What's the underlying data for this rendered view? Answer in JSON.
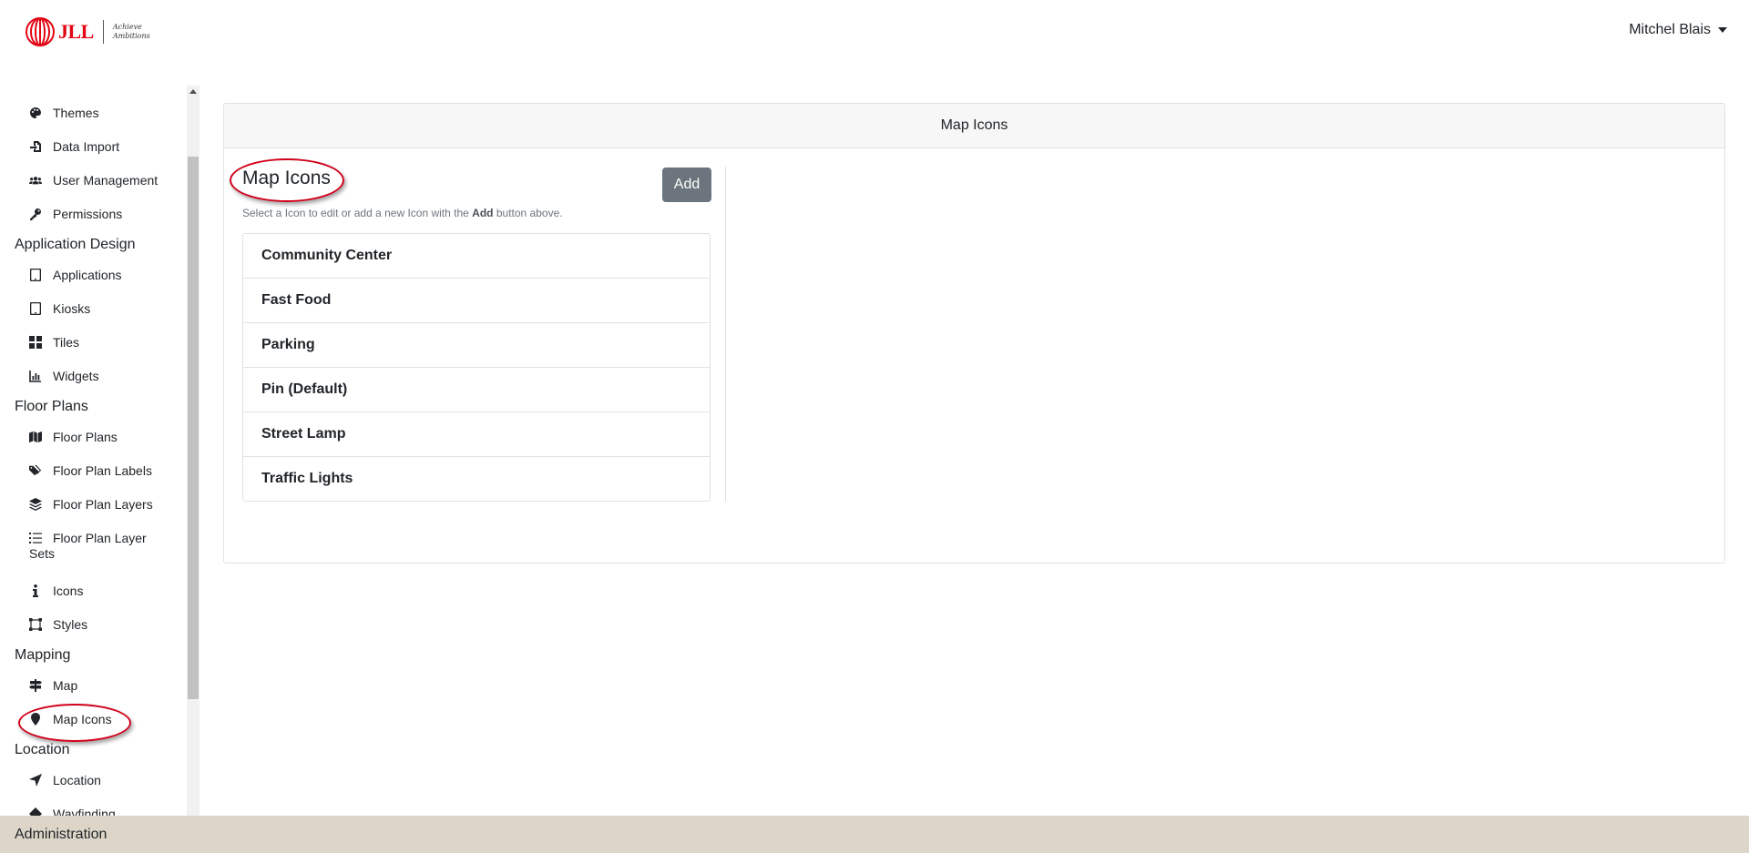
{
  "brand": {
    "logo_text": "JLL",
    "tagline": "Achieve Ambitions",
    "primary_color": "#e30613"
  },
  "user": {
    "name": "Mitchel Blais"
  },
  "sidebar": {
    "groups": [
      {
        "title": "",
        "items": [
          {
            "label": "Themes",
            "icon": "palette-icon"
          },
          {
            "label": "Data Import",
            "icon": "file-import-icon"
          },
          {
            "label": "User Management",
            "icon": "users-icon"
          },
          {
            "label": "Permissions",
            "icon": "key-icon"
          }
        ]
      },
      {
        "title": "Application Design",
        "items": [
          {
            "label": "Applications",
            "icon": "tablet-icon"
          },
          {
            "label": "Kiosks",
            "icon": "tablet-icon"
          },
          {
            "label": "Tiles",
            "icon": "grid-icon"
          },
          {
            "label": "Widgets",
            "icon": "chart-icon"
          }
        ]
      },
      {
        "title": "Floor Plans",
        "items": [
          {
            "label": "Floor Plans",
            "icon": "map-icon"
          },
          {
            "label": "Floor Plan Labels",
            "icon": "tags-icon"
          },
          {
            "label": "Floor Plan Layers",
            "icon": "layers-icon"
          },
          {
            "label": "Floor Plan Layer Sets",
            "icon": "list-icon"
          },
          {
            "label": "Icons",
            "icon": "info-icon"
          },
          {
            "label": "Styles",
            "icon": "vector-square-icon"
          }
        ]
      },
      {
        "title": "Mapping",
        "items": [
          {
            "label": "Map",
            "icon": "signs-icon"
          },
          {
            "label": "Map Icons",
            "icon": "map-marker-icon",
            "active": true
          }
        ]
      },
      {
        "title": "Location",
        "items": [
          {
            "label": "Location",
            "icon": "location-arrow-icon"
          },
          {
            "label": "Wayfinding",
            "icon": "directions-icon"
          }
        ]
      }
    ]
  },
  "card": {
    "header": "Map Icons",
    "panel_title": "Map Icons",
    "add_label": "Add",
    "hint_prefix": "Select a Icon to edit or add a new Icon with the",
    "hint_bold": "Add",
    "hint_suffix": "button above.",
    "items": [
      "Community Center",
      "Fast Food",
      "Parking",
      "Pin (Default)",
      "Street Lamp",
      "Traffic Lights"
    ]
  },
  "footer": {
    "label": "Administration"
  },
  "colors": {
    "highlight": "#d0021b",
    "footer_bg": "#ddd6c8",
    "button_bg": "#6c757d"
  }
}
